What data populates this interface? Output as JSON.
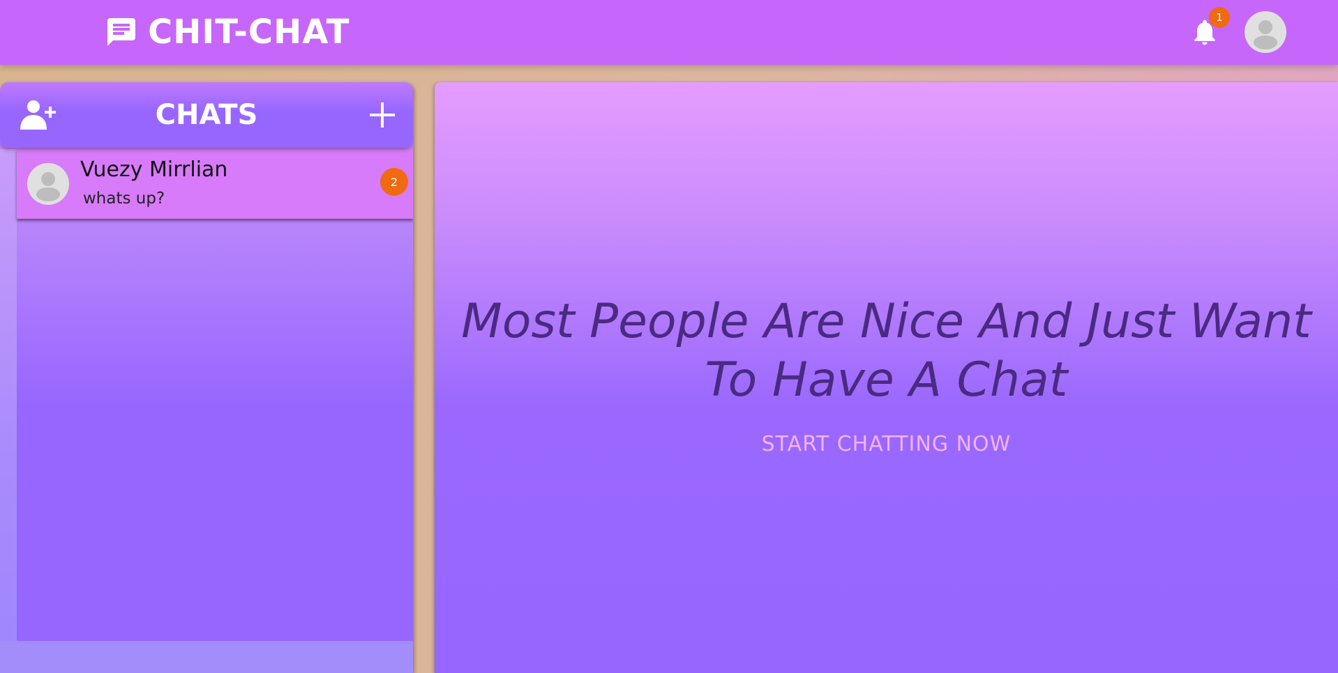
{
  "header": {
    "brand_icon": "chat-message-icon",
    "title": "CHIT-CHAT",
    "notification_icon": "bell-icon",
    "notification_count": "1",
    "avatar_icon": "user-avatar-icon"
  },
  "sidebar": {
    "title": "CHATS",
    "add_user_icon": "add-user-icon",
    "new_chat_icon": "plus-icon",
    "chats": [
      {
        "name": "Vuezy Mirrlian",
        "preview": "whats up?",
        "unread": "2"
      }
    ]
  },
  "main": {
    "tagline": "Most People Are Nice And Just Want To Have A Chat",
    "cta": "START CHATTING NOW"
  },
  "colors": {
    "topbar": "#c666fb",
    "accent": "#9666ff",
    "badge": "#f06a12",
    "tagline_text": "#4b2a82",
    "cta_text": "#f4b3f0"
  }
}
